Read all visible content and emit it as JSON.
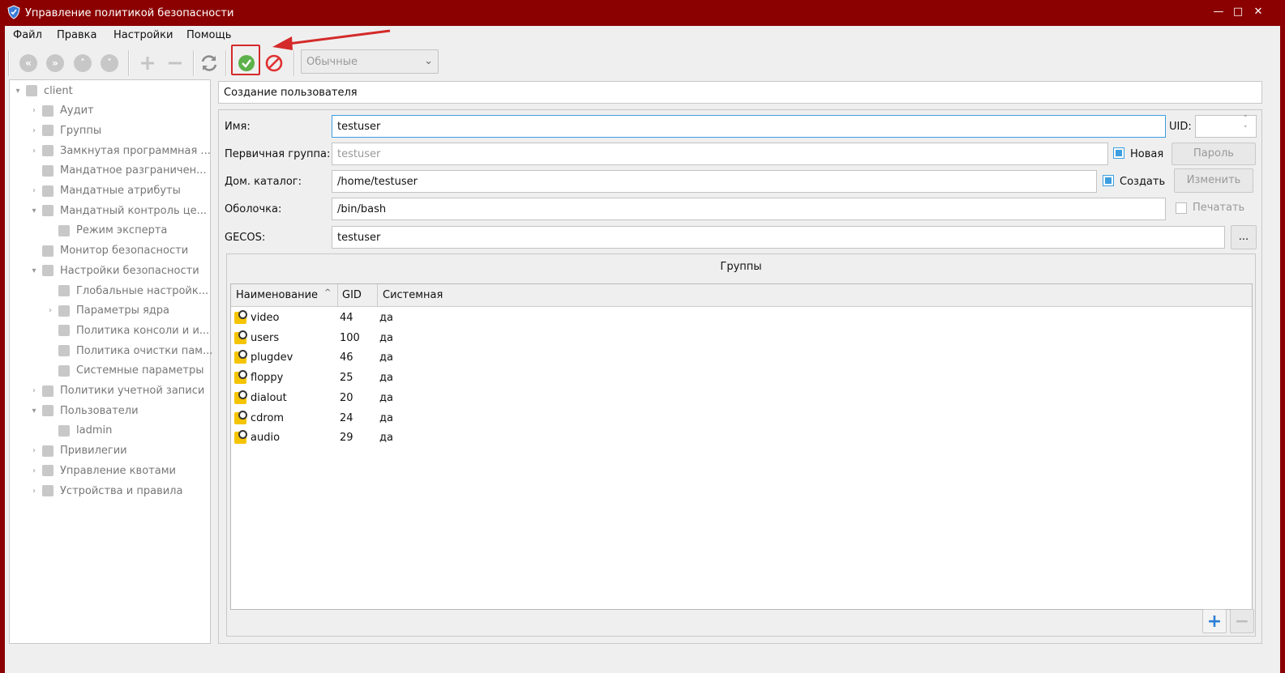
{
  "window": {
    "title": "Управление политикой безопасности",
    "min": "—",
    "max": "□",
    "close": "✕"
  },
  "menu": [
    "Файл",
    "Правка",
    "Настройки",
    "Помощь"
  ],
  "toolbar": {
    "mode_select": "Обычные"
  },
  "tree": [
    {
      "label": "client",
      "level": 0,
      "exp": "▾"
    },
    {
      "label": "Аудит",
      "level": 1,
      "exp": "›"
    },
    {
      "label": "Группы",
      "level": 1,
      "exp": "›"
    },
    {
      "label": "Замкнутая программная ...",
      "level": 1,
      "exp": "›"
    },
    {
      "label": "Мандатное разграничен...",
      "level": 1,
      "exp": ""
    },
    {
      "label": "Мандатные атрибуты",
      "level": 1,
      "exp": "›"
    },
    {
      "label": "Мандатный контроль це...",
      "level": 1,
      "exp": "▾"
    },
    {
      "label": "Режим эксперта",
      "level": 2,
      "exp": ""
    },
    {
      "label": "Монитор безопасности",
      "level": 1,
      "exp": ""
    },
    {
      "label": "Настройки безопасности",
      "level": 1,
      "exp": "▾"
    },
    {
      "label": "Глобальные настройк...",
      "level": 2,
      "exp": ""
    },
    {
      "label": "Параметры ядра",
      "level": 2,
      "exp": "›"
    },
    {
      "label": "Политика консоли и и...",
      "level": 2,
      "exp": ""
    },
    {
      "label": "Политика очистки пам...",
      "level": 2,
      "exp": ""
    },
    {
      "label": "Системные параметры",
      "level": 2,
      "exp": ""
    },
    {
      "label": "Политики учетной записи",
      "level": 1,
      "exp": "›"
    },
    {
      "label": "Пользователи",
      "level": 1,
      "exp": "▾"
    },
    {
      "label": "ladmin",
      "level": 2,
      "exp": ""
    },
    {
      "label": "Привилегии",
      "level": 1,
      "exp": "›"
    },
    {
      "label": "Управление квотами",
      "level": 1,
      "exp": "›"
    },
    {
      "label": "Устройства и правила",
      "level": 1,
      "exp": "›"
    }
  ],
  "panel": {
    "header": "Создание пользователя"
  },
  "form": {
    "name_label": "Имя:",
    "name_value": "testuser",
    "uid_label": "UID:",
    "uid_value": "",
    "group_label": "Первичная группа:",
    "group_value": "testuser",
    "new_label": "Новая",
    "password_label": "Пароль",
    "home_label": "Дом. каталог:",
    "home_value": "/home/testuser",
    "create_label": "Создать",
    "change_label": "Изменить",
    "shell_label": "Оболочка:",
    "shell_value": "/bin/bash",
    "print_label": "Печатать",
    "gecos_label": "GECOS:",
    "gecos_value": "testuser",
    "more_label": "..."
  },
  "groups": {
    "title": "Группы",
    "columns": [
      "Наименование",
      "GID",
      "Системная"
    ],
    "sort_indicator": "^",
    "rows": [
      {
        "name": "video",
        "gid": "44",
        "sys": "да"
      },
      {
        "name": "users",
        "gid": "100",
        "sys": "да"
      },
      {
        "name": "plugdev",
        "gid": "46",
        "sys": "да"
      },
      {
        "name": "floppy",
        "gid": "25",
        "sys": "да"
      },
      {
        "name": "dialout",
        "gid": "20",
        "sys": "да"
      },
      {
        "name": "cdrom",
        "gid": "24",
        "sys": "да"
      },
      {
        "name": "audio",
        "gid": "29",
        "sys": "да"
      }
    ],
    "add": "+",
    "remove": "−"
  }
}
